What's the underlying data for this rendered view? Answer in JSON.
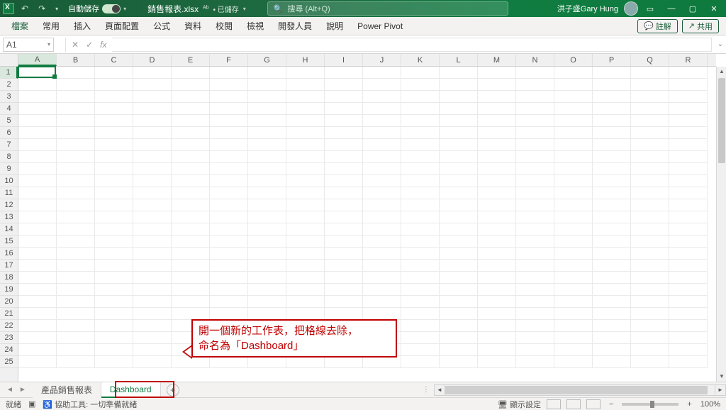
{
  "titlebar": {
    "autosave_label": "自動儲存",
    "autosave_pill": "開啟",
    "filename": "銷售報表.xlsx",
    "sensitivity_icon": "ᴬᵇ",
    "saved_status": "• 已儲存",
    "search_placeholder": "搜尋 (Alt+Q)",
    "username": "洪子盛Gary Hung"
  },
  "ribbon": {
    "tabs": [
      "檔案",
      "常用",
      "插入",
      "頁面配置",
      "公式",
      "資料",
      "校閱",
      "檢視",
      "開發人員",
      "說明",
      "Power Pivot"
    ],
    "comments": "註解",
    "share": "共用"
  },
  "formula_bar": {
    "namebox": "A1",
    "fx_label": "fx"
  },
  "grid": {
    "columns": [
      "A",
      "B",
      "C",
      "D",
      "E",
      "F",
      "G",
      "H",
      "I",
      "J",
      "K",
      "L",
      "M",
      "N",
      "O",
      "P",
      "Q",
      "R"
    ],
    "rows": [
      "1",
      "2",
      "3",
      "4",
      "5",
      "6",
      "7",
      "8",
      "9",
      "10",
      "11",
      "12",
      "13",
      "14",
      "15",
      "16",
      "17",
      "18",
      "19",
      "20",
      "21",
      "22",
      "23",
      "24",
      "25"
    ],
    "active_col": 0,
    "active_row": 0
  },
  "annotation": {
    "line1": "開一個新的工作表，把格線去除，",
    "line2": "命名為「Dashboard」"
  },
  "sheets": {
    "tab1": "產品銷售報表",
    "tab2": "Dashboard",
    "add_tooltip": "+"
  },
  "statusbar": {
    "ready": "就緒",
    "accessibility": "協助工具: 一切準備就緒",
    "display_settings": "顯示設定",
    "zoom": "100%"
  }
}
